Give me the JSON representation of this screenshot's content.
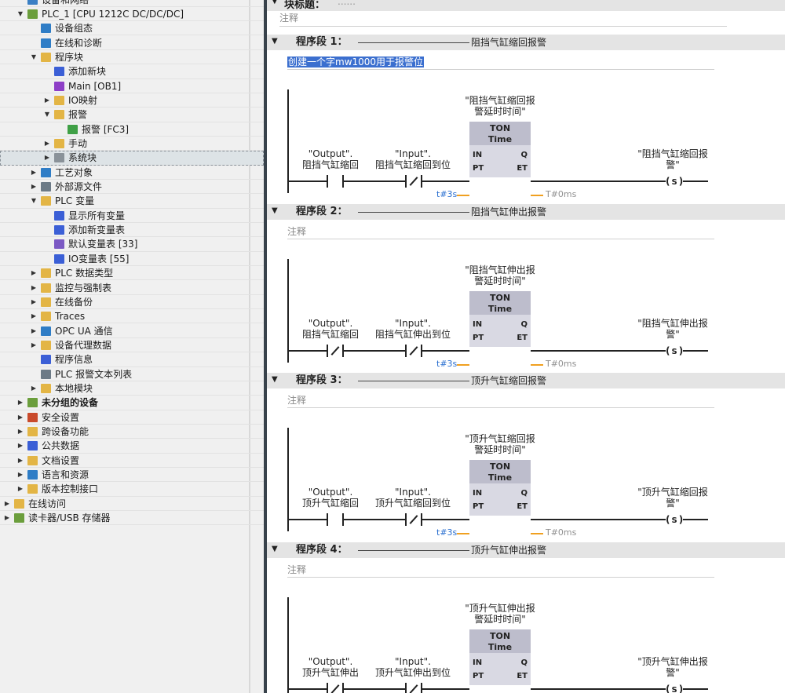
{
  "tree": [
    {
      "label": "设备和网络",
      "indent": 1,
      "twisty": "",
      "icon": "network-icon",
      "color": "#3a7fc4"
    },
    {
      "label": "PLC_1 [CPU 1212C DC/DC/DC]",
      "indent": 1,
      "twisty": "▼",
      "icon": "plc-cpu-icon",
      "color": "#6b9e3c"
    },
    {
      "label": "设备组态",
      "indent": 2,
      "twisty": "",
      "icon": "device-config-icon",
      "color": "#2f7dc6"
    },
    {
      "label": "在线和诊断",
      "indent": 2,
      "twisty": "",
      "icon": "online-diagnostics-icon",
      "color": "#2f7dc6"
    },
    {
      "label": "程序块",
      "indent": 2,
      "twisty": "▼",
      "icon": "folder-icon",
      "color": "#e3b545"
    },
    {
      "label": "添加新块",
      "indent": 3,
      "twisty": "",
      "icon": "add-block-icon",
      "color": "#3b5fd6"
    },
    {
      "label": "Main [OB1]",
      "indent": 3,
      "twisty": "",
      "icon": "ob-block-icon",
      "color": "#8e3fc7"
    },
    {
      "label": "IO映射",
      "indent": 3,
      "twisty": "▶",
      "icon": "folder-icon",
      "color": "#e3b545"
    },
    {
      "label": "报警",
      "indent": 3,
      "twisty": "▼",
      "icon": "folder-icon",
      "color": "#e3b545"
    },
    {
      "label": "报警 [FC3]",
      "indent": 4,
      "twisty": "",
      "icon": "fc-block-icon",
      "color": "#3fa046"
    },
    {
      "label": "手动",
      "indent": 3,
      "twisty": "▶",
      "icon": "folder-icon",
      "color": "#e3b545"
    },
    {
      "label": "系统块",
      "indent": 3,
      "twisty": "▶",
      "icon": "system-block-icon",
      "color": "#8a9299",
      "selected": true
    },
    {
      "label": "工艺对象",
      "indent": 2,
      "twisty": "▶",
      "icon": "technology-object-icon",
      "color": "#2f7dc6"
    },
    {
      "label": "外部源文件",
      "indent": 2,
      "twisty": "▶",
      "icon": "external-source-icon",
      "color": "#6c7a86"
    },
    {
      "label": "PLC 变量",
      "indent": 2,
      "twisty": "▼",
      "icon": "plc-tags-icon",
      "color": "#e3b545"
    },
    {
      "label": "显示所有变量",
      "indent": 3,
      "twisty": "",
      "icon": "show-all-tags-icon",
      "color": "#3b5fd6"
    },
    {
      "label": "添加新变量表",
      "indent": 3,
      "twisty": "",
      "icon": "add-tag-table-icon",
      "color": "#3b5fd6"
    },
    {
      "label": "默认变量表 [33]",
      "indent": 3,
      "twisty": "",
      "icon": "tag-table-icon",
      "color": "#7b59c4"
    },
    {
      "label": "IO变量表 [55]",
      "indent": 3,
      "twisty": "",
      "icon": "tag-table-icon",
      "color": "#3b5fd6"
    },
    {
      "label": "PLC 数据类型",
      "indent": 2,
      "twisty": "▶",
      "icon": "data-type-icon",
      "color": "#e3b545"
    },
    {
      "label": "监控与强制表",
      "indent": 2,
      "twisty": "▶",
      "icon": "watch-force-icon",
      "color": "#e3b545"
    },
    {
      "label": "在线备份",
      "indent": 2,
      "twisty": "▶",
      "icon": "online-backup-icon",
      "color": "#e3b545"
    },
    {
      "label": "Traces",
      "indent": 2,
      "twisty": "▶",
      "icon": "traces-icon",
      "color": "#e3b545"
    },
    {
      "label": "OPC UA 通信",
      "indent": 2,
      "twisty": "▶",
      "icon": "opc-ua-icon",
      "color": "#2f7dc6"
    },
    {
      "label": "设备代理数据",
      "indent": 2,
      "twisty": "▶",
      "icon": "proxy-data-icon",
      "color": "#e3b545"
    },
    {
      "label": "程序信息",
      "indent": 2,
      "twisty": "",
      "icon": "program-info-icon",
      "color": "#3b5fd6"
    },
    {
      "label": "PLC 报警文本列表",
      "indent": 2,
      "twisty": "",
      "icon": "alarm-text-list-icon",
      "color": "#6c7a86"
    },
    {
      "label": "本地模块",
      "indent": 2,
      "twisty": "▶",
      "icon": "local-modules-icon",
      "color": "#e3b545"
    },
    {
      "label": "未分组的设备",
      "indent": 1,
      "twisty": "▶",
      "icon": "ungrouped-devices-icon",
      "color": "#6b9e3c",
      "bold": true
    },
    {
      "label": "安全设置",
      "indent": 1,
      "twisty": "▶",
      "icon": "security-icon",
      "color": "#c94a2b"
    },
    {
      "label": "跨设备功能",
      "indent": 1,
      "twisty": "▶",
      "icon": "cross-device-icon",
      "color": "#e3b545"
    },
    {
      "label": "公共数据",
      "indent": 1,
      "twisty": "▶",
      "icon": "common-data-icon",
      "color": "#3b5fd6"
    },
    {
      "label": "文档设置",
      "indent": 1,
      "twisty": "▶",
      "icon": "document-settings-icon",
      "color": "#e3b545"
    },
    {
      "label": "语言和资源",
      "indent": 1,
      "twisty": "▶",
      "icon": "language-icon",
      "color": "#2f7dc6"
    },
    {
      "label": "版本控制接口",
      "indent": 1,
      "twisty": "▶",
      "icon": "version-control-icon",
      "color": "#e3b545"
    },
    {
      "label": "在线访问",
      "indent": 0,
      "twisty": "▶",
      "icon": "online-access-icon",
      "color": "#e3b545"
    },
    {
      "label": "读卡器/USB 存储器",
      "indent": 0,
      "twisty": "▶",
      "icon": "card-reader-icon",
      "color": "#6b9e3c"
    }
  ],
  "block": {
    "title_label": "块标题：",
    "title_value": "......"
  },
  "timer": {
    "type": "TON",
    "subtype": "Time",
    "pin_in": "IN",
    "pin_pt": "PT",
    "pin_q": "Q",
    "pin_et": "ET",
    "pt_value": "t#3s",
    "et_value": "T#0ms"
  },
  "networks": [
    {
      "label": "程序段 1：",
      "title": "阻挡气缸缩回报警",
      "comment": "创建一个字mw1000用于报警位",
      "comment_selected": true,
      "contact1_line1": "\"Output\".",
      "contact1_line2": "阻挡气缸缩回",
      "contact1_type": "NO",
      "contact2_line1": "\"Input\".",
      "contact2_line2": "阻挡气缸缩回到位",
      "contact2_type": "NC",
      "timer_line1": "\"阻挡气缸缩回报",
      "timer_line2": "警延时时间\"",
      "coil_line1": "\"阻挡气缸缩回报",
      "coil_line2": "警\"",
      "coil": "S"
    },
    {
      "label": "程序段 2：",
      "title": "阻挡气缸伸出报警",
      "comment": "注释",
      "comment_selected": false,
      "contact1_line1": "\"Output\".",
      "contact1_line2": "阻挡气缸缩回",
      "contact1_type": "NC",
      "contact2_line1": "\"Input\".",
      "contact2_line2": "阻挡气缸伸出到位",
      "contact2_type": "NC",
      "timer_line1": "\"阻挡气缸伸出报",
      "timer_line2": "警延时时间\"",
      "coil_line1": "\"阻挡气缸伸出报",
      "coil_line2": "警\"",
      "coil": "S"
    },
    {
      "label": "程序段 3：",
      "title": "顶升气缸缩回报警",
      "comment": "注释",
      "comment_selected": false,
      "contact1_line1": "\"Output\".",
      "contact1_line2": "顶升气缸缩回",
      "contact1_type": "NO",
      "contact2_line1": "\"Input\".",
      "contact2_line2": "顶升气缸缩回到位",
      "contact2_type": "NC",
      "timer_line1": "\"顶升气缸缩回报",
      "timer_line2": "警延时时间\"",
      "coil_line1": "\"顶升气缸缩回报",
      "coil_line2": "警\"",
      "coil": "S"
    },
    {
      "label": "程序段 4：",
      "title": "顶升气缸伸出报警",
      "comment": "注释",
      "comment_selected": false,
      "contact1_line1": "\"Output\".",
      "contact1_line2": "顶升气缸伸出",
      "contact1_type": "NC",
      "contact2_line1": "\"Input\".",
      "contact2_line2": "顶升气缸伸出到位",
      "contact2_type": "NC",
      "timer_line1": "\"顶升气缸伸出报",
      "timer_line2": "警延时时间\"",
      "coil_line1": "\"顶升气缸伸出报",
      "coil_line2": "警\"",
      "coil": "S"
    }
  ],
  "colors": {
    "selection": "#3b6fcf",
    "pt_text": "#2a6fd0",
    "et_text": "#909090",
    "orange_line": "#f0a020",
    "rung": "#222222"
  }
}
